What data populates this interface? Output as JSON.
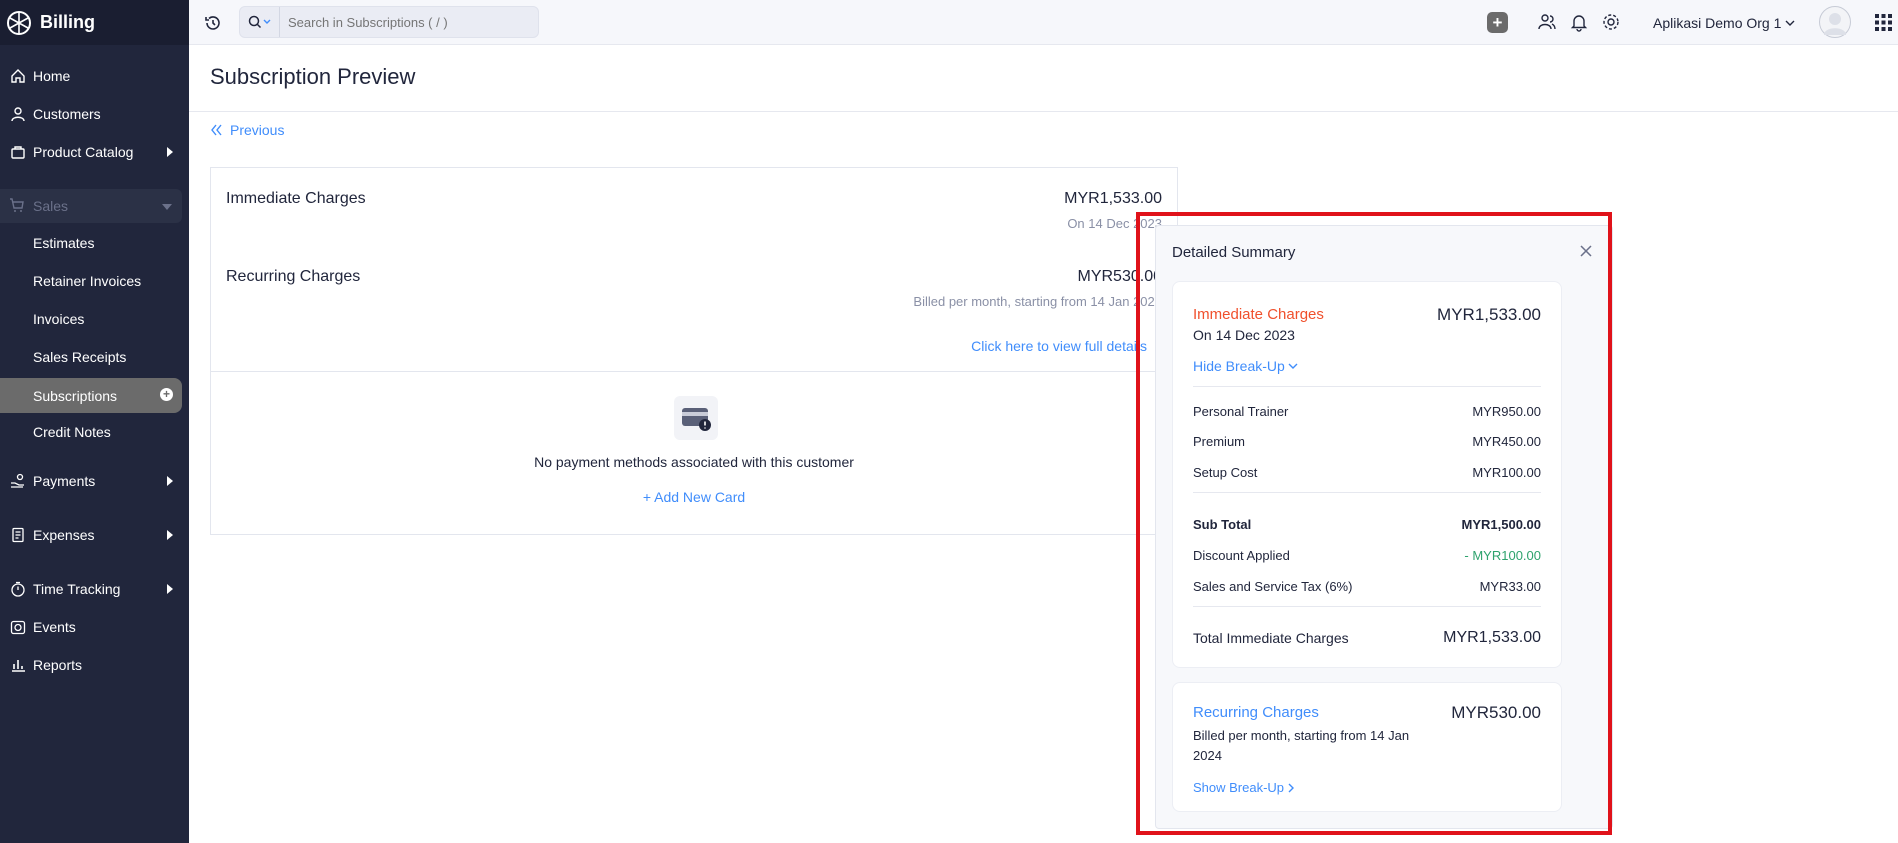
{
  "app": {
    "name": "Billing"
  },
  "sidebar": {
    "items": [
      {
        "label": "Home",
        "icon": "home-icon"
      },
      {
        "label": "Customers",
        "icon": "user-icon"
      },
      {
        "label": "Product Catalog",
        "icon": "bag-icon"
      },
      {
        "label": "Sales",
        "icon": "cart-icon"
      },
      {
        "label": "Payments",
        "icon": "hand-coin-icon"
      },
      {
        "label": "Expenses",
        "icon": "receipt-icon"
      },
      {
        "label": "Time Tracking",
        "icon": "stopwatch-icon"
      },
      {
        "label": "Events",
        "icon": "camera-icon"
      },
      {
        "label": "Reports",
        "icon": "bar-chart-icon"
      }
    ],
    "sales_sub": [
      "Estimates",
      "Retainer Invoices",
      "Invoices",
      "Sales Receipts",
      "Subscriptions",
      "Credit Notes"
    ]
  },
  "topbar": {
    "search_placeholder": "Search in Subscriptions ( / )",
    "org_name": "Aplikasi Demo Org 1"
  },
  "page": {
    "title": "Subscription Preview",
    "previous_label": "Previous"
  },
  "summary_card": {
    "immediate_label": "Immediate Charges",
    "immediate_amount": "MYR1,533.00",
    "immediate_date": "On 14 Dec 2023",
    "recurring_label": "Recurring Charges",
    "recurring_amount": "MYR530.00",
    "recurring_note": "Billed per month, starting from 14 Jan 2024",
    "view_details_link": "Click here to view full details",
    "no_payment_text": "No payment methods associated with this customer",
    "add_card_link": "+ Add New Card"
  },
  "detailed_summary": {
    "title": "Detailed Summary",
    "immediate": {
      "label": "Immediate Charges",
      "amount": "MYR1,533.00",
      "date": "On 14 Dec 2023",
      "toggle": "Hide Break-Up",
      "items": [
        {
          "name": "Personal Trainer",
          "amount": "MYR950.00"
        },
        {
          "name": "Premium",
          "amount": "MYR450.00"
        },
        {
          "name": "Setup Cost",
          "amount": "MYR100.00"
        }
      ],
      "subtotal_label": "Sub Total",
      "subtotal_amount": "MYR1,500.00",
      "discount_label": "Discount Applied",
      "discount_amount": "- MYR100.00",
      "tax_label": "Sales and Service Tax (6%)",
      "tax_amount": "MYR33.00",
      "total_label": "Total Immediate Charges",
      "total_amount": "MYR1,533.00"
    },
    "recurring": {
      "label": "Recurring Charges",
      "amount": "MYR530.00",
      "note": "Billed per month, starting from 14 Jan 2024",
      "toggle": "Show Break-Up"
    }
  },
  "colors": {
    "sidebar_bg": "#21263c",
    "link_blue": "#408dfb",
    "immediate_orange": "#f0502c",
    "discount_green": "#2ea26d",
    "highlight_red": "#e0121a"
  }
}
